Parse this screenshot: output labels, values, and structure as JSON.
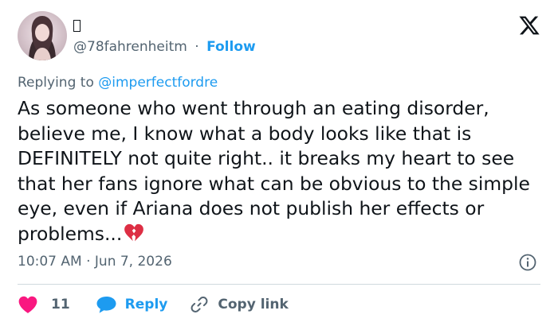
{
  "user": {
    "display_name": "",
    "handle": "@78fahrenheitm",
    "separator": "·",
    "follow_label": "Follow",
    "avatar_icon": "profile-photo"
  },
  "reply_context": {
    "prefix": "Replying to",
    "username": "@imperfectfordre"
  },
  "tweet": {
    "text": "As someone who went through an eating disorder, believe me, I know what a body looks like that is DEFINITELY not quite right.. it breaks my heart to see that her fans ignore what can be obvious to the simple eye, even if Ariana does not publish her effects or problems...",
    "emoji": "broken-heart-emoji",
    "timestamp": "10:07 AM · Jun 7, 2026"
  },
  "actions": {
    "like_count": "11",
    "reply_label": "Reply",
    "copy_link_label": "Copy link"
  },
  "colors": {
    "accent": "#1d9bf0",
    "like": "#f91880",
    "muted": "#536471",
    "text": "#0f1419",
    "divider": "#cfd9de"
  }
}
